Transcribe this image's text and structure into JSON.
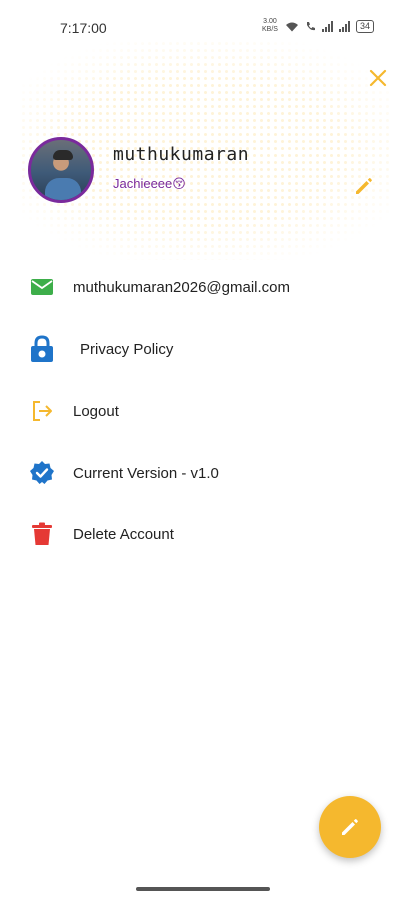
{
  "status_bar": {
    "time": "7:17:00",
    "network_speed": "3.00 KB/S",
    "battery": "34"
  },
  "profile": {
    "name": "muthukumaran",
    "nickname": "Jachieeee😚"
  },
  "menu": [
    {
      "label": "muthukumaran2026@gmail.com",
      "icon": "email-icon",
      "color": "#3dae4a"
    },
    {
      "label": "Privacy Policy",
      "icon": "lock-icon",
      "color": "#1f74c9"
    },
    {
      "label": "Logout",
      "icon": "logout-icon",
      "color": "#f5b82e"
    },
    {
      "label": "Current Version - v1.0",
      "icon": "verified-icon",
      "color": "#1f74c9"
    },
    {
      "label": "Delete Account",
      "icon": "trash-icon",
      "color": "#e53935"
    }
  ],
  "colors": {
    "accent": "#f5b82e",
    "purple": "#7a2a9c"
  }
}
